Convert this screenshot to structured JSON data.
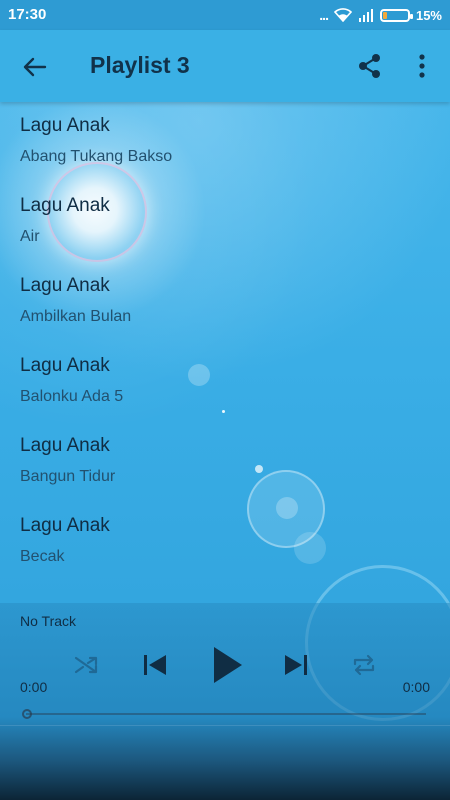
{
  "status_bar": {
    "time": "17:30",
    "signal_dots": "...",
    "battery_percent": "15%",
    "battery_level": 0.15
  },
  "app_bar": {
    "title": "Playlist 3",
    "icons": {
      "back": "arrow-left-icon",
      "share": "share-icon",
      "more": "more-vertical-icon"
    }
  },
  "playlist": {
    "items": [
      {
        "artist": "Lagu Anak",
        "title": "Abang Tukang Bakso"
      },
      {
        "artist": "Lagu Anak",
        "title": "Air"
      },
      {
        "artist": "Lagu Anak",
        "title": "Ambilkan Bulan"
      },
      {
        "artist": "Lagu Anak",
        "title": "Balonku Ada 5"
      },
      {
        "artist": "Lagu Anak",
        "title": "Bangun Tidur"
      },
      {
        "artist": "Lagu Anak",
        "title": "Becak"
      }
    ]
  },
  "player": {
    "now_playing": "No Track",
    "current_time": "0:00",
    "total_time": "0:00",
    "progress": 0,
    "controls": [
      "shuffle-icon",
      "skip-previous-icon",
      "play-icon",
      "skip-next-icon",
      "repeat-icon"
    ]
  },
  "colors": {
    "background": "#3fb0e6",
    "app_bar": "#3ab0e5",
    "status_bar": "#2e9bd3",
    "text_primary": "#102d44",
    "text_secondary": "#22516f",
    "battery_fill": "#f2a93b"
  }
}
